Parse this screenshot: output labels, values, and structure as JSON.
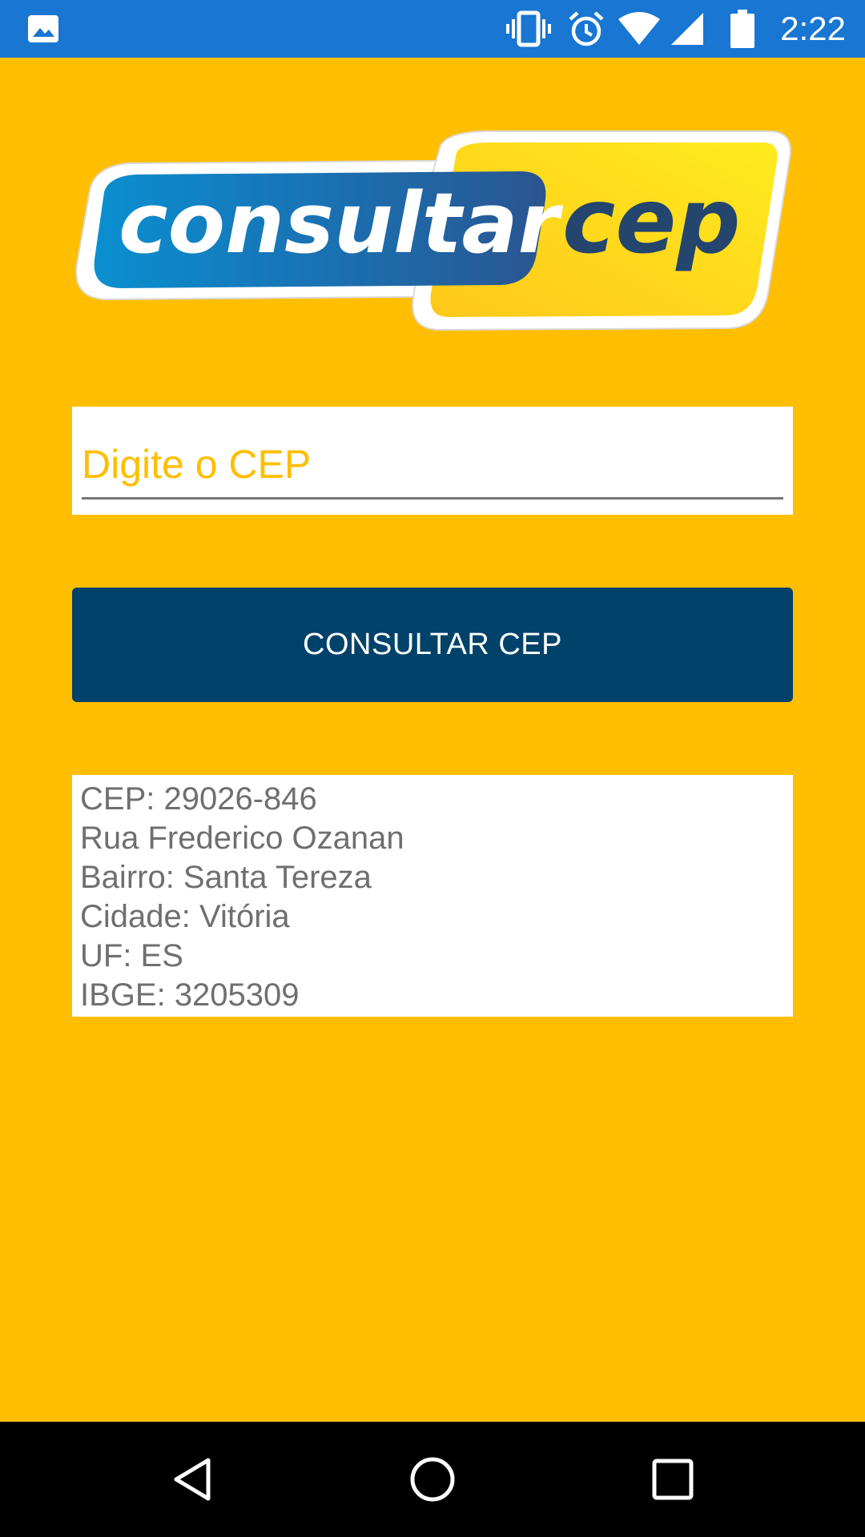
{
  "status_bar": {
    "time": "2:22",
    "icons": [
      "gallery-icon",
      "vibrate-icon",
      "alarm-icon",
      "wifi-icon",
      "signal-icon",
      "battery-icon"
    ],
    "background": "#1976D2"
  },
  "logo": {
    "word_left": "consultar",
    "word_right": "cep"
  },
  "search": {
    "placeholder": "Digite o CEP",
    "value": ""
  },
  "button": {
    "label": "CONSULTAR CEP"
  },
  "result": {
    "lines": [
      "CEP: 29026-846",
      "Rua Frederico Ozanan",
      "Bairro: Santa Tereza",
      "Cidade: Vitória",
      "UF: ES",
      "IBGE: 3205309"
    ]
  },
  "nav_bar": {
    "icons": [
      "back-icon",
      "home-icon",
      "recents-icon"
    ]
  },
  "colors": {
    "background": "#FFBE00",
    "button": "#01426A",
    "logo_blue": "#1B6FB0",
    "logo_navy": "#23456E"
  }
}
